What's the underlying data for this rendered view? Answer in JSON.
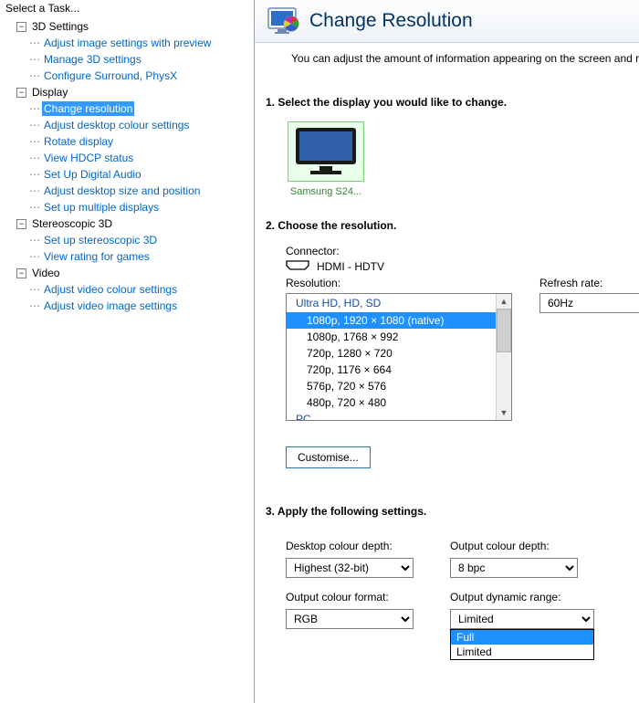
{
  "sidebar": {
    "title": "Select a Task...",
    "groups": [
      {
        "label": "3D Settings",
        "items": [
          "Adjust image settings with preview",
          "Manage 3D settings",
          "Configure Surround, PhysX"
        ]
      },
      {
        "label": "Display",
        "items": [
          "Change resolution",
          "Adjust desktop colour settings",
          "Rotate display",
          "View HDCP status",
          "Set Up Digital Audio",
          "Adjust desktop size and position",
          "Set up multiple displays"
        ],
        "selected_index": 0
      },
      {
        "label": "Stereoscopic 3D",
        "items": [
          "Set up stereoscopic 3D",
          "View rating for games"
        ]
      },
      {
        "label": "Video",
        "items": [
          "Adjust video colour settings",
          "Adjust video image settings"
        ]
      }
    ]
  },
  "header": {
    "title": "Change Resolution",
    "subtext": "You can adjust the amount of information appearing on the screen and reduce flicke"
  },
  "steps": {
    "s1": "1. Select the display you would like to change.",
    "s2": "2. Choose the resolution.",
    "s3": "3. Apply the following settings."
  },
  "monitor": {
    "label": "Samsung S24..."
  },
  "connector": {
    "label": "Connector:",
    "value": "HDMI - HDTV"
  },
  "resolution": {
    "label": "Resolution:",
    "group_header": "Ultra HD, HD, SD",
    "items": [
      "1080p, 1920 × 1080 (native)",
      "1080p, 1768 × 992",
      "720p, 1280 × 720",
      "720p, 1176 × 664",
      "576p, 720 × 576",
      "480p, 720 × 480"
    ],
    "next_group_cutoff": "PC",
    "selected_index": 0
  },
  "refresh": {
    "label": "Refresh rate:",
    "value": "60Hz"
  },
  "customise_btn": "Customise...",
  "settings": {
    "desktop_depth": {
      "label": "Desktop colour depth:",
      "value": "Highest (32-bit)"
    },
    "output_depth": {
      "label": "Output colour depth:",
      "value": "8 bpc"
    },
    "output_format": {
      "label": "Output colour format:",
      "value": "RGB"
    },
    "output_range": {
      "label": "Output dynamic range:",
      "value": "Limited",
      "options": [
        "Full",
        "Limited"
      ],
      "highlight_index": 0
    }
  }
}
